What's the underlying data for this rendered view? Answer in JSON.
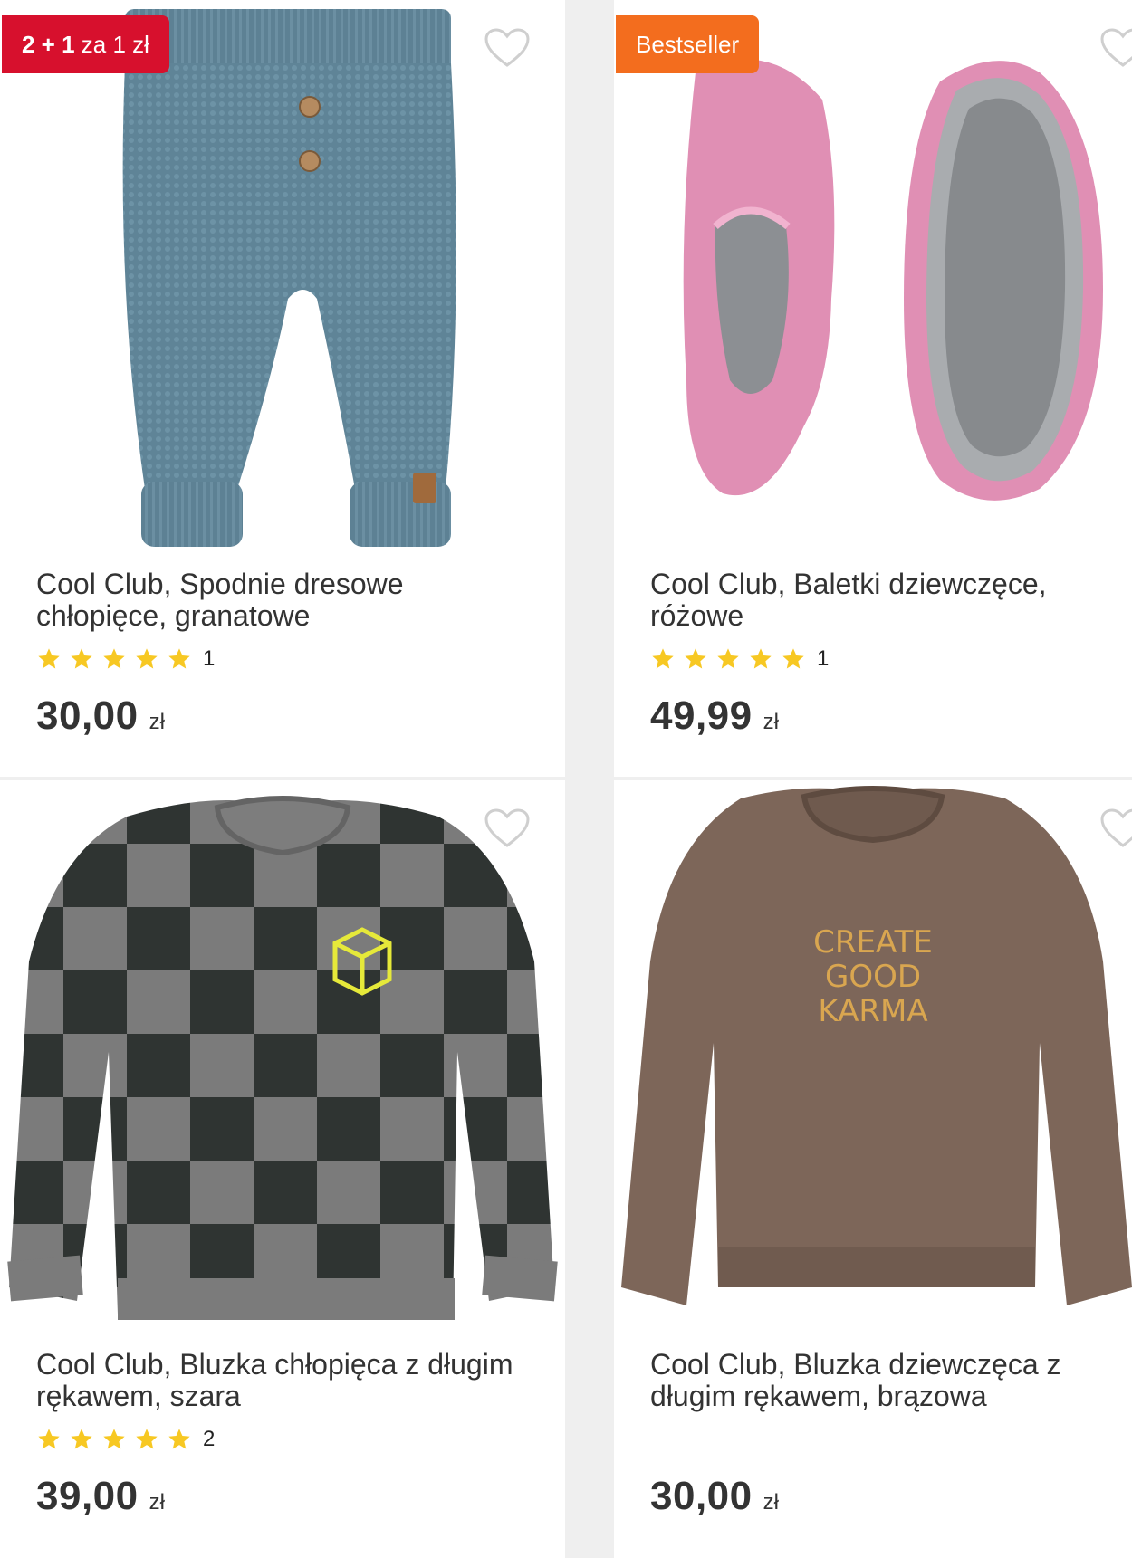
{
  "colors": {
    "badge_promo": "#d7102d",
    "badge_bestseller": "#f36d1e",
    "star": "#f7c823",
    "text": "#333333"
  },
  "products": [
    {
      "badge": {
        "strong": "2 + 1",
        "rest": " za 1 zł"
      },
      "title": "Cool Club, Spodnie dresowe chłopięce, granatowe",
      "rating_count": "1",
      "rating_stars": 5,
      "price": "30,00",
      "currency": "zł",
      "favorite_icon": "heart-outline-icon"
    },
    {
      "badge": {
        "strong": "",
        "rest": "Bestseller"
      },
      "title": "Cool Club, Baletki dziewczęce, różowe",
      "rating_count": "1",
      "rating_stars": 5,
      "price": "49,99",
      "currency": "zł",
      "favorite_icon": "heart-outline-icon"
    },
    {
      "title": "Cool Club, Bluzka chłopięca z długim rękawem, szara",
      "rating_count": "2",
      "rating_stars": 5,
      "price": "39,00",
      "currency": "zł",
      "favorite_icon": "heart-outline-icon"
    },
    {
      "title": "Cool Club, Bluzka dziewczęca z długim rękawem, brązowa",
      "sweater_print": [
        "CREATE",
        "GOOD",
        "KARMA"
      ],
      "price": "30,00",
      "currency": "zł",
      "favorite_icon": "heart-outline-icon"
    }
  ]
}
